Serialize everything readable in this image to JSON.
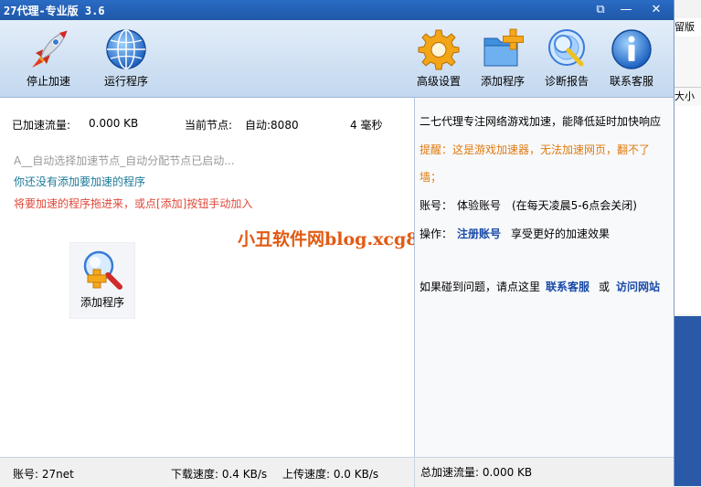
{
  "window": {
    "title": "27代理-专业版 3.6"
  },
  "title_buttons": {
    "restore": "⧉",
    "minimize": "—",
    "close": "✕"
  },
  "toolbar": {
    "left": [
      {
        "label": "停止加速",
        "icon": "rocket-icon"
      },
      {
        "label": "运行程序",
        "icon": "globe-icon"
      }
    ],
    "right": [
      {
        "label": "高级设置",
        "icon": "gear-icon"
      },
      {
        "label": "添加程序",
        "icon": "folder-add-icon"
      },
      {
        "label": "诊断报告",
        "icon": "magnifier-cd-icon"
      },
      {
        "label": "联系客服",
        "icon": "info-icon"
      }
    ]
  },
  "left_panel": {
    "accel_traffic_label": "已加速流量:",
    "accel_traffic_value": "0.000 KB",
    "node_label": "当前节点:",
    "node_value": "自动:8080",
    "latency": "4 毫秒",
    "auto_status": "A__自动选择加速节点_自动分配节点已启动...",
    "no_program": "你还没有添加要加速的程序",
    "hint": "将要加速的程序拖进来，或点[添加]按钮手动加入",
    "add_program_label": "添加程序"
  },
  "watermark": "小丑软件网blog.xcg888.cn",
  "right_panel": {
    "slogan": "二七代理专注网络游戏加速，能降低延时加快响应",
    "reminder_line1": "提醒：这是游戏加速器，无法加速网页，翻不了",
    "reminder_line2": "墙；",
    "account_label": "账号：",
    "account_value": "体验账号",
    "account_note": "(在每天凌晨5-6点会关闭)",
    "op_label": "操作：",
    "register_link": "注册账号",
    "op_text": "享受更好的加速效果",
    "help_text": "如果碰到问题，请点这里",
    "support_link": "联系客服",
    "or_text": "或",
    "visit_link": "访问网站"
  },
  "statusbar": {
    "account": "账号: 27net",
    "download": "下载速度: 0.4 KB/s",
    "upload": "上传速度: 0.0 KB/s",
    "total": "总加速流量: 0.000 KB"
  },
  "background_window": {
    "text1": "留版",
    "text2": "大小"
  },
  "colors": {
    "title_bar": "#1f58a8",
    "toolbar_bg": "#cfe0f3",
    "link_blue": "#1a4ba8",
    "warning_orange": "#e07a10",
    "hint_red": "#e0483a",
    "info_teal": "#1a7a9a",
    "watermark": "#e25a12"
  }
}
